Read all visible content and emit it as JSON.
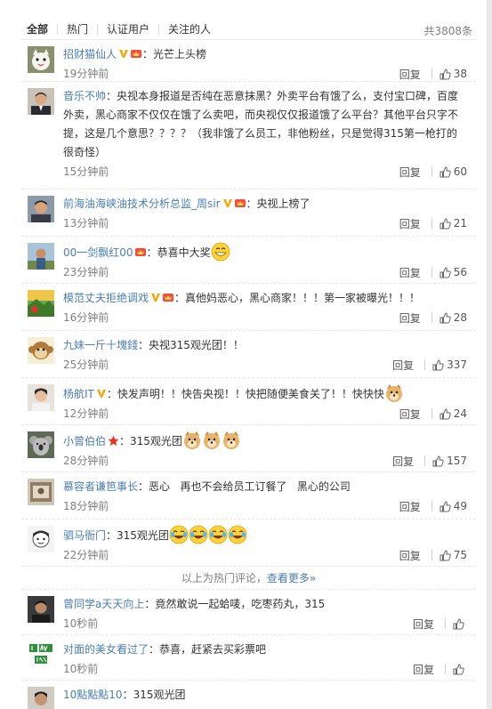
{
  "tabs": [
    "全部",
    "热门",
    "认证用户",
    "关注的人"
  ],
  "total": "共3808条",
  "reply_label": "回复",
  "comments": [
    {
      "user": "招财猫仙人",
      "text": "光芒上头榜",
      "time": "19分钟前",
      "likes": "38",
      "avatar": "cat-avatar",
      "badges": [
        "verified-v",
        "vip"
      ]
    },
    {
      "user": "音乐不帅",
      "text": "央视本身报道是否纯在恶意抹黑？外卖平台有饿了么，支付宝口碑，百度外卖，黑心商家不仅仅在饿了么卖吧，而央视仅仅报道饿了么平台？其他平台只字不提，这是几个意思？？？？（我非饿了么员工，非他粉丝，只是觉得315第一枪打的很奇怪）",
      "time": "15分钟前",
      "likes": "60",
      "avatar": "man-suit-avatar",
      "badges": []
    },
    {
      "user": "前海油海峡油技术分析总监_周sir",
      "text": "央视上榜了",
      "time": "13分钟前",
      "likes": "21",
      "avatar": "man-avatar",
      "badges": [
        "verified-v",
        "vip"
      ]
    },
    {
      "user": "00一剑飘红00",
      "text": "恭喜中大奖",
      "time": "23分钟前",
      "likes": "56",
      "avatar": "man-outdoor-avatar",
      "badges": [
        "vip"
      ],
      "emojis": [
        "grin-emoji"
      ]
    },
    {
      "user": "模范丈夫拒绝调戏",
      "text": "真他妈恶心，黑心商家！！！第一家被曝光！！！",
      "time": "16分钟前",
      "likes": "28",
      "avatar": "landscape-avatar",
      "badges": [
        "verified-v",
        "vip"
      ]
    },
    {
      "user": "九妹一斤十塊錢",
      "text": "央视315观光团！！",
      "time": "25分钟前",
      "likes": "337",
      "avatar": "monkey-avatar",
      "badges": []
    },
    {
      "user": "杨航IT",
      "text": "快发声明！！快告央视！！快把随便美食关了！！快快快",
      "time": "12分钟前",
      "likes": "24",
      "avatar": "boy-avatar",
      "badges": [
        "verified-v"
      ],
      "emojis": [
        "doge-emoji"
      ]
    },
    {
      "user": "小曾伯伯",
      "text": "315观光团",
      "time": "28分钟前",
      "likes": "157",
      "avatar": "koala-avatar",
      "badges": [
        "star"
      ],
      "emojis": [
        "doge-emoji",
        "doge-emoji",
        "doge-emoji"
      ]
    },
    {
      "user": "慕容者谦笆事长",
      "text": "恶心   再也不会给员工订餐了   黑心的公司",
      "time": "18分钟前",
      "likes": "49",
      "avatar": "photo-avatar",
      "badges": []
    },
    {
      "user": "驷马衙门",
      "text": "315观光团",
      "time": "22分钟前",
      "likes": "75",
      "avatar": "cartoon-avatar",
      "badges": [],
      "emojis": [
        "laugh-cry-emoji",
        "laugh-cry-emoji",
        "laugh-cry-emoji",
        "laugh-cry-emoji"
      ]
    }
  ],
  "hot_footer": {
    "prefix": "以上为热门评论，",
    "more": "查看更多»"
  },
  "recent": [
    {
      "user": "曾同学a天天向上",
      "text": "竟然敢说一起蛤唛，吃枣药丸，315",
      "time": "10秒前",
      "avatar": "man-dark-avatar"
    },
    {
      "user": "对面的美女看过了",
      "text": "恭喜，赶紧去买彩票吧",
      "time": "10秒前",
      "avatar": "i-am-avatar"
    },
    {
      "user": "10點點點10",
      "text": "315观光团",
      "time": "",
      "avatar": "man-partial-avatar"
    }
  ]
}
